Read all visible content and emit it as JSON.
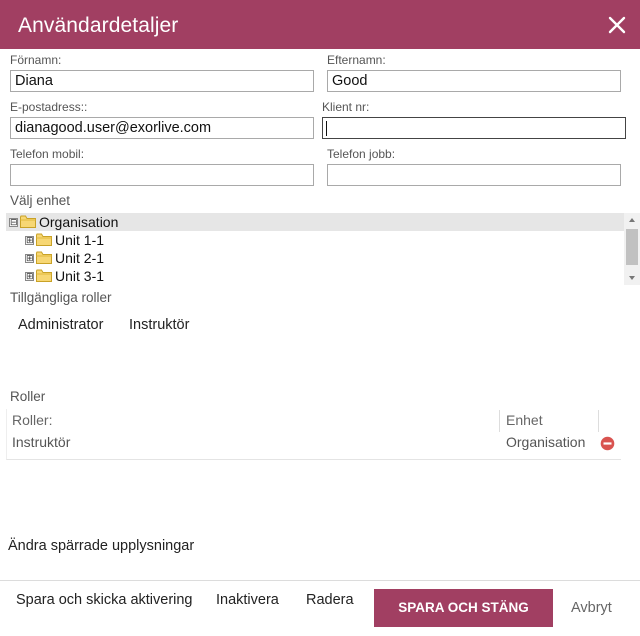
{
  "dialog": {
    "title": "Användardetaljer",
    "close_icon": "close-icon"
  },
  "form": {
    "first_name": {
      "label": "Förnamn:",
      "value": "Diana"
    },
    "last_name": {
      "label": "Efternamn:",
      "value": "Good"
    },
    "email": {
      "label": "E-postadress::",
      "value": "dianagood.user@exorlive.com"
    },
    "client_nr": {
      "label": "Klient nr:",
      "value": ""
    },
    "phone_mobile": {
      "label": "Telefon mobil:",
      "value": ""
    },
    "phone_work": {
      "label": "Telefon jobb:",
      "value": ""
    }
  },
  "unit_select": {
    "label": "Välj enhet",
    "tree": [
      {
        "label": "Organisation",
        "expander": "⊟",
        "icon": "folder-icon",
        "selected": true,
        "level": 0
      },
      {
        "label": "Unit 1-1",
        "expander": "⊞",
        "icon": "folder-icon",
        "selected": false,
        "level": 1
      },
      {
        "label": "Unit 2-1",
        "expander": "⊞",
        "icon": "folder-icon",
        "selected": false,
        "level": 1
      },
      {
        "label": "Unit 3-1",
        "expander": "⊞",
        "icon": "folder-icon",
        "selected": false,
        "level": 1
      }
    ]
  },
  "available_roles": {
    "label": "Tillgängliga roller",
    "items": [
      "Administrator",
      "Instruktör"
    ]
  },
  "roles": {
    "label": "Roller",
    "columns": [
      "Roller:",
      "Enhet"
    ],
    "rows": [
      {
        "role": "Instruktör",
        "unit": "Organisation",
        "action_icon": "remove-icon"
      }
    ]
  },
  "locked_info_link": "Ändra spärrade upplysningar",
  "footer": {
    "send_activation": "Spara och skicka aktivering",
    "deactivate": "Inaktivera",
    "delete": "Radera",
    "save_close": "SPARA OCH STÄNG",
    "cancel": "Avbryt"
  },
  "colors": {
    "accent": "#a13f62",
    "remove": "#d9534f"
  }
}
